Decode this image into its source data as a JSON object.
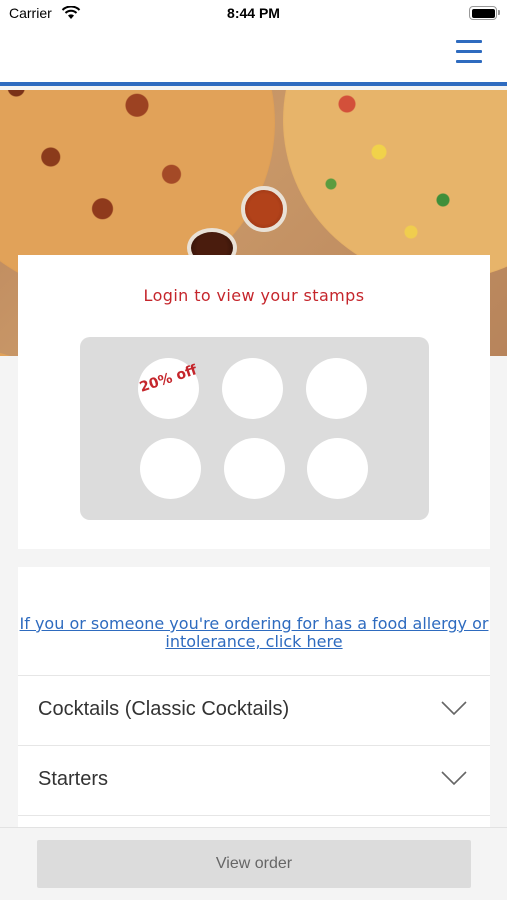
{
  "status_bar": {
    "carrier": "Carrier",
    "time": "8:44 PM",
    "wifi_icon": "wifi-icon",
    "battery_icon": "battery-icon"
  },
  "header": {
    "menu_icon": "hamburger-menu-icon",
    "accent_color": "#2e6bbf"
  },
  "hero": {
    "image": "pizza-banner-image"
  },
  "stamps": {
    "title": "Login to view your stamps",
    "reward_label": "20% off",
    "total_stamps": 6,
    "title_color": "#c5262c"
  },
  "menu": {
    "allergy_link": "If you or someone you're ordering for has a food allergy or intolerance, click here",
    "categories": [
      {
        "label": "Cocktails (Classic Cocktails)",
        "icon": "chevron-down-icon"
      },
      {
        "label": "Starters",
        "icon": "chevron-down-icon"
      }
    ]
  },
  "footer": {
    "view_order_label": "View order"
  }
}
